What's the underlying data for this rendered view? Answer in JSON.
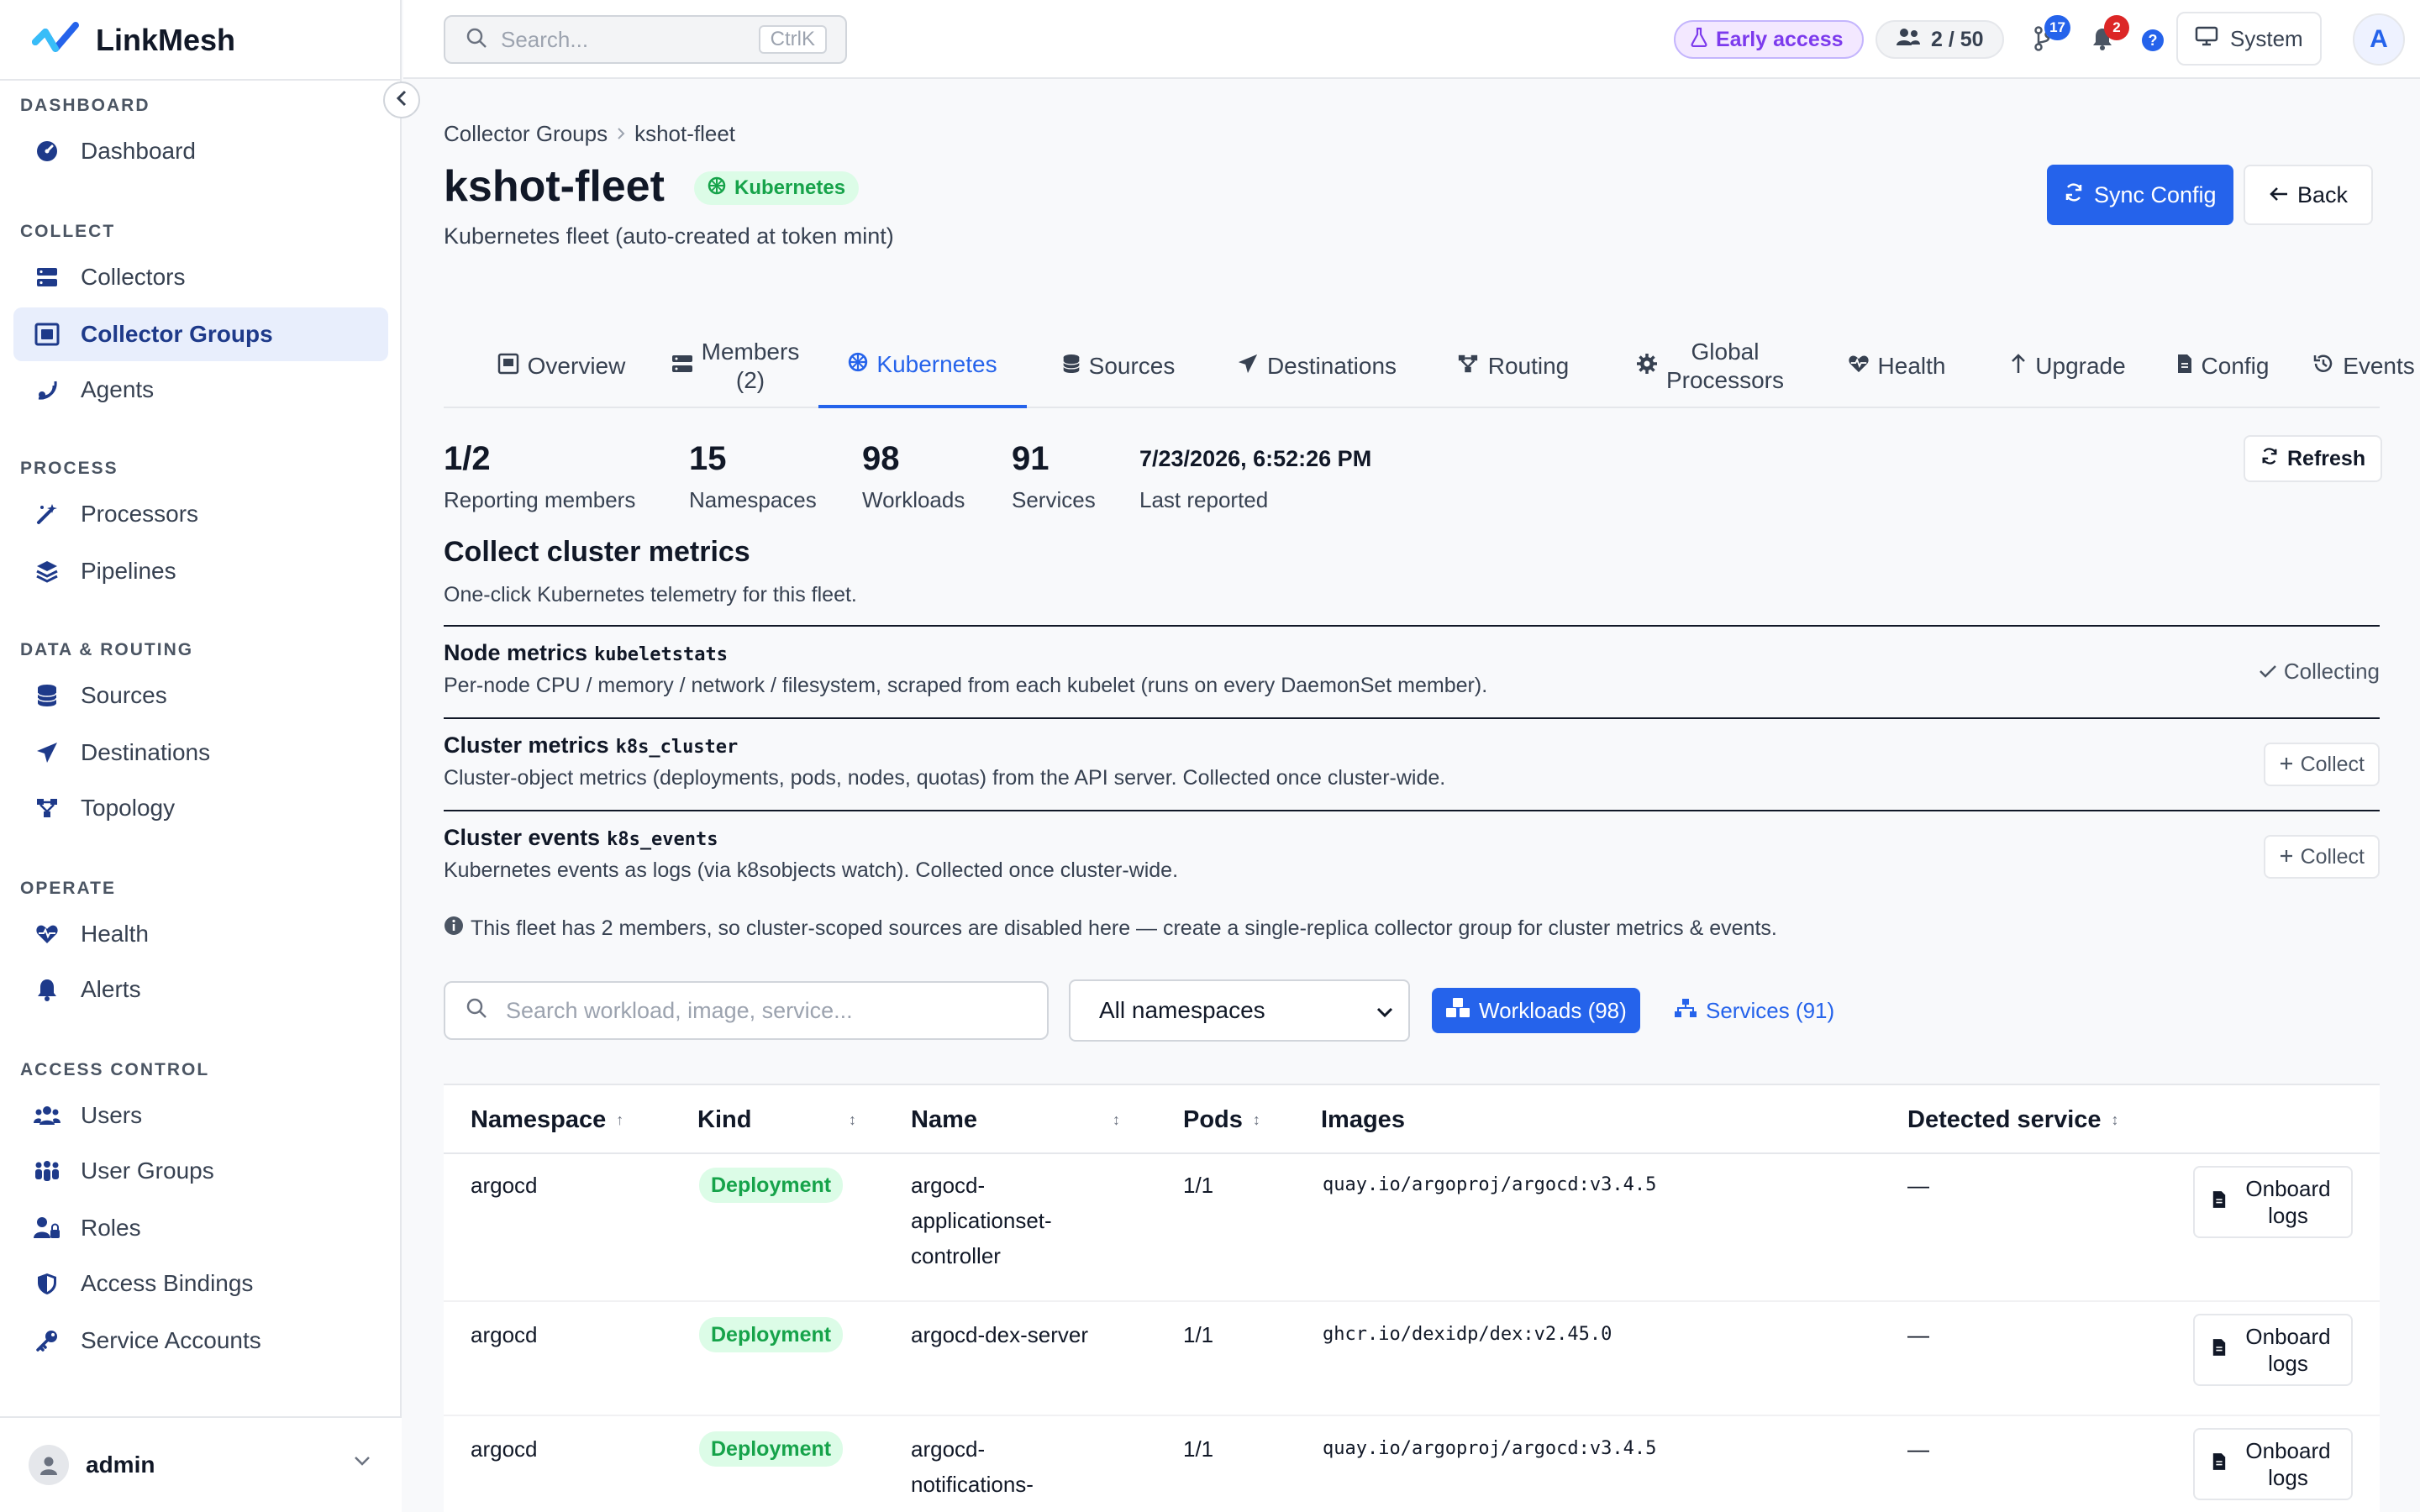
{
  "app": {
    "name": "LinkMesh"
  },
  "sidebar": {
    "sections": [
      {
        "label": "DASHBOARD",
        "items": [
          {
            "label": "Dashboard",
            "icon": "gauge-icon"
          }
        ]
      },
      {
        "label": "COLLECT",
        "items": [
          {
            "label": "Collectors",
            "icon": "server-icon"
          },
          {
            "label": "Collector Groups",
            "icon": "group-icon",
            "active": true
          },
          {
            "label": "Agents",
            "icon": "satellite-icon"
          }
        ]
      },
      {
        "label": "PROCESS",
        "items": [
          {
            "label": "Processors",
            "icon": "wand-icon"
          },
          {
            "label": "Pipelines",
            "icon": "layers-icon"
          }
        ]
      },
      {
        "label": "DATA & ROUTING",
        "items": [
          {
            "label": "Sources",
            "icon": "database-icon"
          },
          {
            "label": "Destinations",
            "icon": "send-icon"
          },
          {
            "label": "Topology",
            "icon": "topology-icon"
          }
        ]
      },
      {
        "label": "OPERATE",
        "items": [
          {
            "label": "Health",
            "icon": "heart-pulse-icon"
          },
          {
            "label": "Alerts",
            "icon": "bell-icon"
          }
        ]
      },
      {
        "label": "ACCESS CONTROL",
        "items": [
          {
            "label": "Users",
            "icon": "users-icon"
          },
          {
            "label": "User Groups",
            "icon": "people-group-icon"
          },
          {
            "label": "Roles",
            "icon": "user-lock-icon"
          },
          {
            "label": "Access Bindings",
            "icon": "shield-icon"
          },
          {
            "label": "Service Accounts",
            "icon": "key-icon"
          }
        ]
      }
    ],
    "user": {
      "name": "admin"
    }
  },
  "topbar": {
    "search_placeholder": "Search...",
    "search_shortcut": "CtrlK",
    "early_access": "Early access",
    "members_count": "2 / 50",
    "git_badge": "17",
    "notif_badge": "2",
    "help": "?",
    "system_label": "System",
    "avatar_letter": "A"
  },
  "page": {
    "breadcrumb": [
      "Collector Groups",
      "kshot-fleet"
    ],
    "title": "kshot-fleet",
    "chip": "Kubernetes",
    "subtitle": "Kubernetes fleet (auto-created at token mint)",
    "sync_label": "Sync Config",
    "back_label": "Back"
  },
  "tabs": [
    {
      "label": "Overview",
      "icon": "overview-icon"
    },
    {
      "label": "Members (2)",
      "line1": "Members",
      "line2": "(2)",
      "icon": "server-icon"
    },
    {
      "label": "Kubernetes",
      "icon": "helm-icon",
      "active": true
    },
    {
      "label": "Sources",
      "icon": "database-icon"
    },
    {
      "label": "Destinations",
      "icon": "send-icon"
    },
    {
      "label": "Routing",
      "icon": "routing-icon"
    },
    {
      "label": "Global Processors",
      "line1": "Global",
      "line2": "Processors",
      "icon": "gear-icon"
    },
    {
      "label": "Health",
      "icon": "heart-pulse-icon"
    },
    {
      "label": "Upgrade",
      "icon": "arrow-up-icon"
    },
    {
      "label": "Config",
      "icon": "file-icon"
    },
    {
      "label": "Events",
      "icon": "history-icon"
    }
  ],
  "stats": [
    {
      "value": "1/2",
      "label": "Reporting members"
    },
    {
      "value": "15",
      "label": "Namespaces"
    },
    {
      "value": "98",
      "label": "Workloads"
    },
    {
      "value": "91",
      "label": "Services"
    },
    {
      "value": "7/23/2026, 6:52:26 PM",
      "label": "Last reported"
    }
  ],
  "refresh_label": "Refresh",
  "cluster_metrics": {
    "title": "Collect cluster metrics",
    "description": "One-click Kubernetes telemetry for this fleet.",
    "rows": [
      {
        "title": "Node metrics",
        "code": "kubeletstats",
        "desc": "Per-node CPU / memory / network / filesystem, scraped from each kubelet (runs on every DaemonSet member).",
        "status": "Collecting"
      },
      {
        "title": "Cluster metrics",
        "code": "k8s_cluster",
        "desc": "Cluster-object metrics (deployments, pods, nodes, quotas) from the API server. Collected once cluster-wide.",
        "action": "Collect"
      },
      {
        "title": "Cluster events",
        "code": "k8s_events",
        "desc": "Kubernetes events as logs (via k8sobjects watch). Collected once cluster-wide.",
        "action": "Collect"
      }
    ],
    "note": "This fleet has 2 members, so cluster-scoped sources are disabled here — create a single-replica collector group for cluster metrics & events."
  },
  "filters": {
    "search_placeholder": "Search workload, image, service...",
    "namespace_value": "All namespaces",
    "workloads_label": "Workloads (98)",
    "services_label": "Services (91)"
  },
  "table": {
    "columns": [
      "Namespace",
      "Kind",
      "Name",
      "Pods",
      "Images",
      "Detected service"
    ],
    "sort_asc": "↑",
    "sort_both": "↕",
    "action_label": "Onboard logs",
    "action_line1": "Onboard",
    "action_line2": "logs",
    "rows": [
      {
        "namespace": "argocd",
        "kind": "Deployment",
        "name": "argocd-applicationset-controller",
        "name_lines": [
          "argocd-",
          "applicationset-",
          "controller"
        ],
        "pods": "1/1",
        "image": "quay.io/argoproj/argocd:v3.4.5",
        "service": "—"
      },
      {
        "namespace": "argocd",
        "kind": "Deployment",
        "name": "argocd-dex-server",
        "name_lines": [
          "argocd-dex-server"
        ],
        "pods": "1/1",
        "image": "ghcr.io/dexidp/dex:v2.45.0",
        "service": "—"
      },
      {
        "namespace": "argocd",
        "kind": "Deployment",
        "name": "argocd-notifications-",
        "name_lines": [
          "argocd-",
          "notifications-"
        ],
        "pods": "1/1",
        "image": "quay.io/argoproj/argocd:v3.4.5",
        "service": "—"
      }
    ]
  },
  "colors": {
    "primary": "#2563eb",
    "success": "#16a34a",
    "success_bg": "#dcfce7",
    "active_nav_bg": "#e8eefc",
    "early_access": "#7c3aed",
    "danger": "#dc2626"
  }
}
